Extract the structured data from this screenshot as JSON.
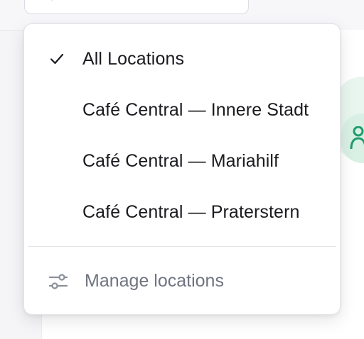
{
  "menu": {
    "items": [
      {
        "label": "All Locations",
        "selected": true
      },
      {
        "label": "Café Central — Innere Stadt",
        "selected": false
      },
      {
        "label": "Café Central — Mariahilf",
        "selected": false
      },
      {
        "label": "Café Central — Praterstern",
        "selected": false
      }
    ],
    "manage_label": "Manage locations"
  },
  "icons": {
    "check": "check-icon",
    "manage": "sliders-icon",
    "trigger": "chevron-down-icon",
    "avatar": "user-icon"
  },
  "colors": {
    "accent_green": "#1f9d6b",
    "text_primary": "#1a1a1f",
    "text_muted": "#6f7480"
  }
}
